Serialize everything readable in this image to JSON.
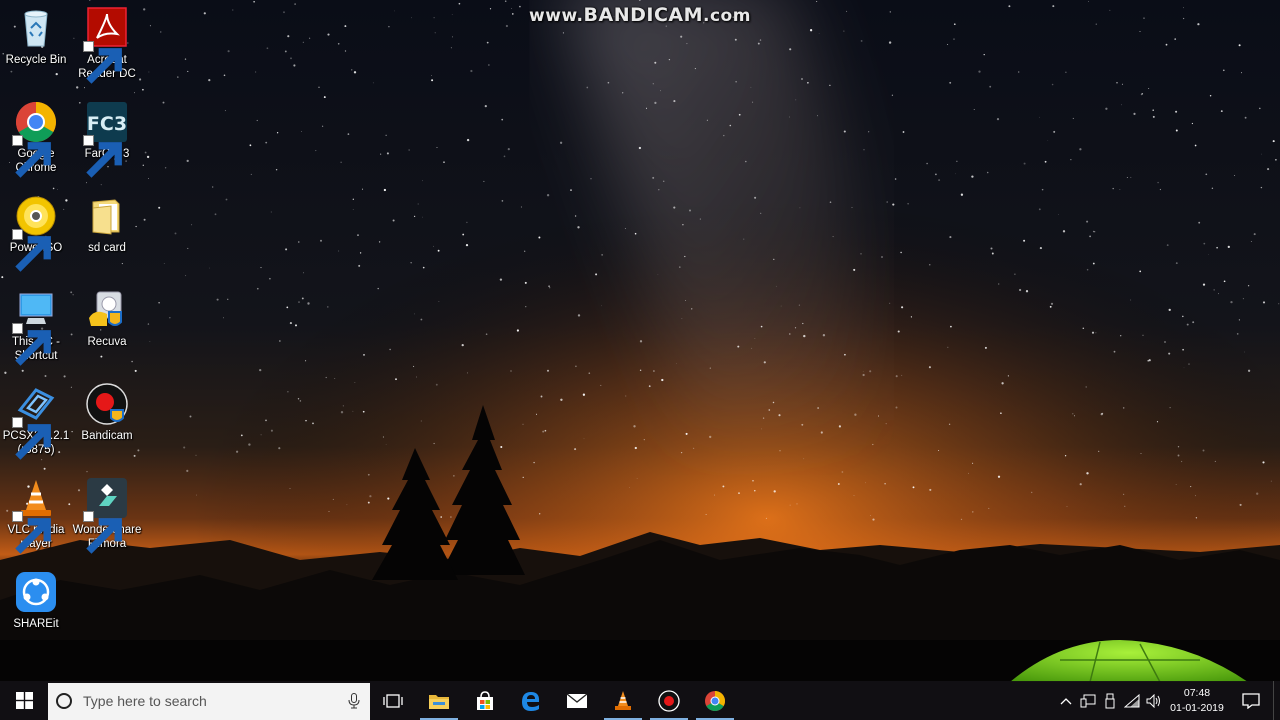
{
  "watermark": {
    "prefix": "www.",
    "brand": "BANDICAM",
    "suffix": ".com"
  },
  "desktop_icons": [
    {
      "label": "Recycle Bin",
      "icon": "recycle-bin-icon",
      "shortcut": false
    },
    {
      "label": "Acrobat Reader DC",
      "icon": "acrobat-reader-icon",
      "shortcut": true
    },
    {
      "label": "Google Chrome",
      "icon": "chrome-icon",
      "shortcut": true
    },
    {
      "label": "FarCry 3",
      "icon": "farcry3-icon",
      "shortcut": true
    },
    {
      "label": "PowerISO",
      "icon": "poweriso-icon",
      "shortcut": true
    },
    {
      "label": "sd card",
      "icon": "folder-icon",
      "shortcut": false
    },
    {
      "label": "This PC - Shortcut",
      "icon": "this-pc-icon",
      "shortcut": true
    },
    {
      "label": "Recuva",
      "icon": "recuva-icon",
      "shortcut": false
    },
    {
      "label": "PCSX2 1.2.1 (r5875)",
      "icon": "pcsx2-icon",
      "shortcut": true
    },
    {
      "label": "Bandicam",
      "icon": "bandicam-icon",
      "shortcut": false
    },
    {
      "label": "VLC media player",
      "icon": "vlc-icon",
      "shortcut": true
    },
    {
      "label": "Wondershare Filmora",
      "icon": "filmora-icon",
      "shortcut": true
    },
    {
      "label": "SHAREit",
      "icon": "shareit-icon",
      "shortcut": false
    }
  ],
  "taskbar": {
    "start_icon": "windows-logo-icon",
    "search_placeholder": "Type here to search",
    "pinned": [
      {
        "name": "task-view",
        "icon": "task-view-icon"
      },
      {
        "name": "file-explorer",
        "icon": "file-explorer-icon"
      },
      {
        "name": "store",
        "icon": "store-icon"
      },
      {
        "name": "edge",
        "icon": "edge-icon"
      },
      {
        "name": "mail",
        "icon": "mail-icon"
      },
      {
        "name": "vlc",
        "icon": "vlc-icon"
      },
      {
        "name": "bandicam",
        "icon": "bandicam-icon"
      },
      {
        "name": "chrome",
        "icon": "chrome-icon"
      }
    ],
    "tray": {
      "icons": [
        "chevron-up-icon",
        "devices-icon",
        "usb-icon",
        "wifi-icon",
        "volume-icon"
      ],
      "time": "07:48",
      "date": "01-01-2019",
      "notification_icon": "action-center-icon"
    }
  },
  "colors": {
    "sky_top": "#0b0e18",
    "horizon_glow": "#e0701c",
    "tent_green": "#7cd81e",
    "taskbar": "#121014"
  }
}
